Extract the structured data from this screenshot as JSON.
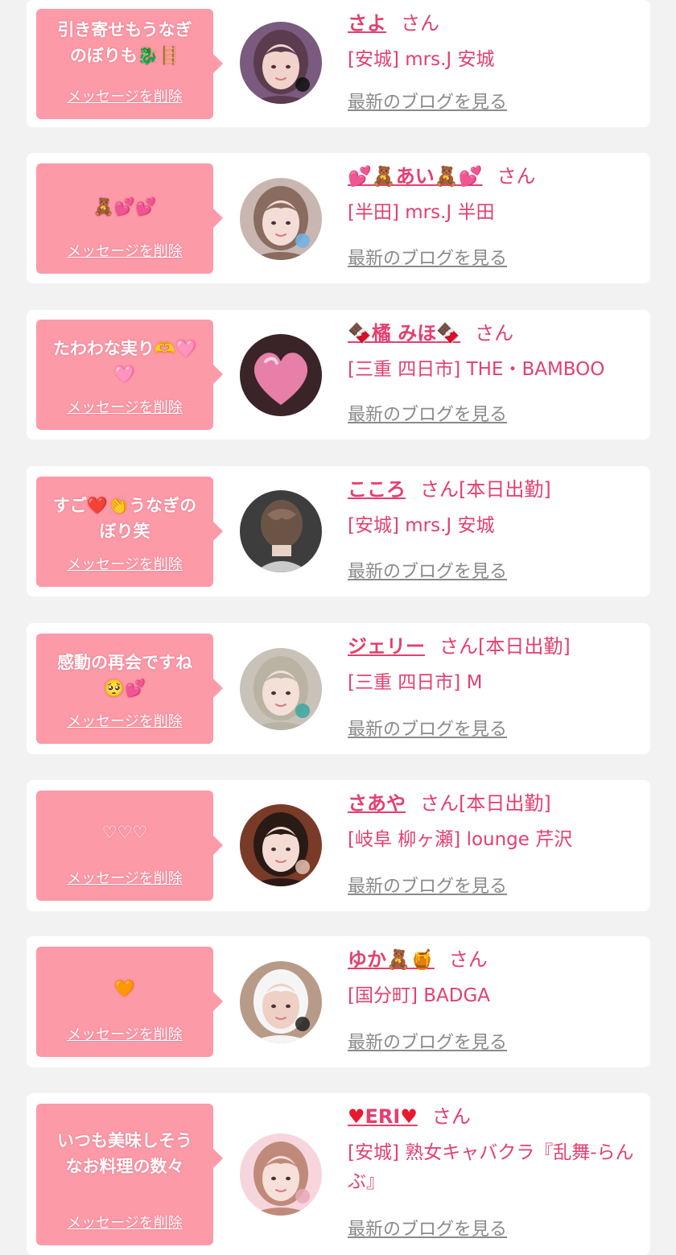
{
  "theme": {
    "bubble": "#fd9aa8",
    "name": "#e43f6f",
    "link_gray": "#8a8a8a",
    "background": "#f2f2f2"
  },
  "messages": [
    {
      "bubble_text": "引き寄せもうなぎ\nのぼりも🐉🪜",
      "delete_label": "メッセージを削除",
      "name": "さよ",
      "name_prefix": "",
      "name_suffix": "",
      "honorific": "さん",
      "shop": "[安城] mrs.J 安城",
      "blog_label": "最新のブログを見る",
      "avatar_icon": "girl-photo-hearts"
    },
    {
      "bubble_text": "🧸💕💕",
      "delete_label": "メッセージを削除",
      "name": "あい",
      "name_prefix": "💕🧸",
      "name_suffix": "🧸💕",
      "honorific": "さん",
      "shop": "[半田] mrs.J 半田",
      "blog_label": "最新のブログを見る",
      "avatar_icon": "girl-photo-filter"
    },
    {
      "bubble_text": "たわわな実り🫶🩷\n🩷",
      "delete_label": "メッセージを削除",
      "name": "橘 みほ",
      "name_prefix": "🍫",
      "name_suffix": "🍫",
      "honorific": "さん",
      "shop": "[三重 四日市] THE・BAMBOO",
      "blog_label": "最新のブログを見る",
      "avatar_icon": "pink-heart-photo"
    },
    {
      "bubble_text": "すご❤️👏うなぎの\nぼり笑",
      "delete_label": "メッセージを削除",
      "name": "こころ",
      "name_prefix": "",
      "name_suffix": "",
      "honorific": "さん[本日出勤]",
      "shop": "[安城] mrs.J 安城",
      "blog_label": "最新のブログを見る",
      "avatar_icon": "hair-updo-photo"
    },
    {
      "bubble_text": "感動の再会ですね\n🥺💕",
      "delete_label": "メッセージを削除",
      "name": "ジェリー",
      "name_prefix": "",
      "name_suffix": "",
      "honorific": "さん[本日出勤]",
      "shop": "[三重 四日市] M",
      "blog_label": "最新のブログを見る",
      "avatar_icon": "girl-photo-blonde"
    },
    {
      "bubble_text": "♡♡♡",
      "delete_label": "メッセージを削除",
      "name": "さあや",
      "name_prefix": "",
      "name_suffix": "",
      "honorific": "さん[本日出勤]",
      "shop": "[岐阜 柳ヶ瀬] lounge 芹沢",
      "blog_label": "最新のブログを見る",
      "avatar_icon": "girl-photo-darkhair"
    },
    {
      "bubble_text": "🧡",
      "delete_label": "メッセージを削除",
      "name": "ゆか",
      "name_prefix": "",
      "name_suffix": "🧸🍯",
      "honorific": "さん",
      "shop": "[国分町] BADGA",
      "blog_label": "最新のブログを見る",
      "avatar_icon": "girl-photo-cowprint"
    },
    {
      "bubble_text": "いつも美味しそう\nなお料理の数々",
      "delete_label": "メッセージを削除",
      "name": "ERI",
      "name_prefix": "♥",
      "name_suffix": "♥",
      "honorific": "さん",
      "shop": "[安城] 熟女キャバクラ『乱舞-らんぶ』",
      "blog_label": "最新のブログを見る",
      "avatar_icon": "girl-photo-pink"
    }
  ]
}
